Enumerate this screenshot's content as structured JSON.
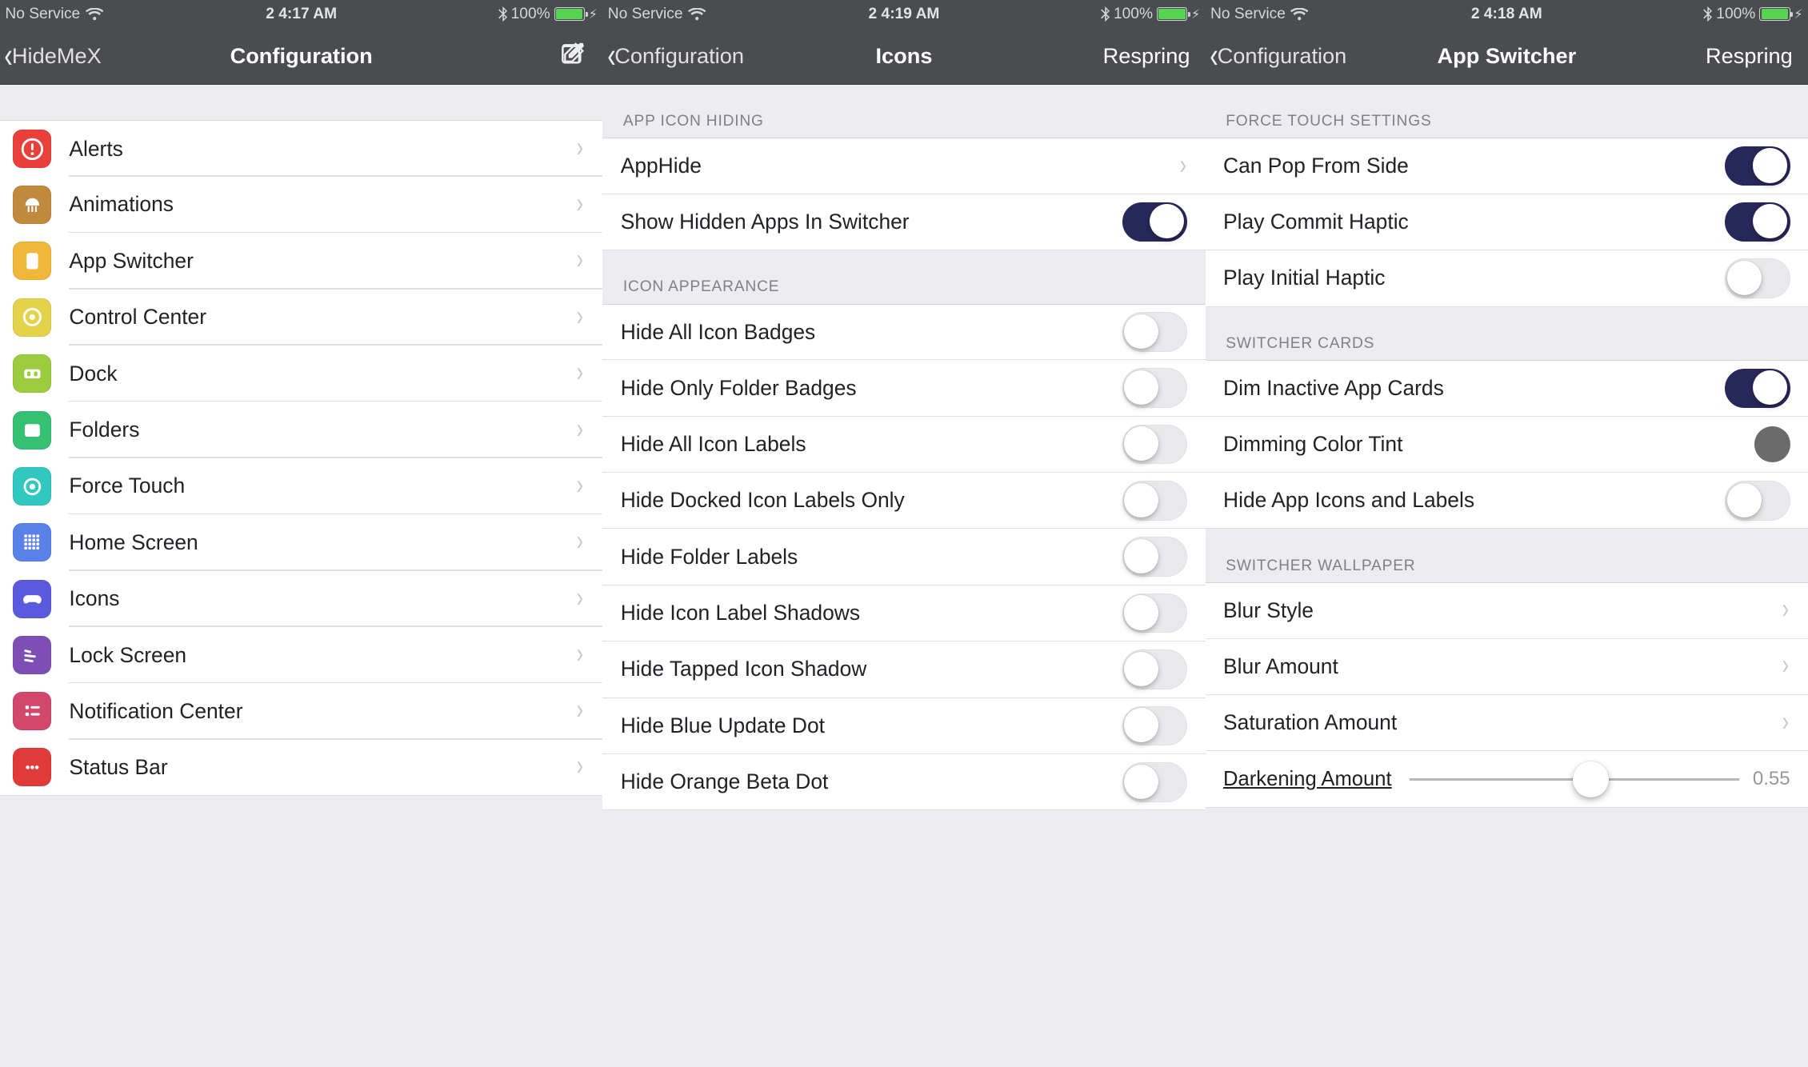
{
  "status": {
    "carrier": "No Service",
    "times": [
      "2 4:17 AM",
      "2 4:19 AM",
      "2 4:18 AM"
    ],
    "battery_pct": "100%"
  },
  "screen1": {
    "back_label": "HideMeX",
    "title": "Configuration",
    "rows": [
      {
        "label": "Alerts",
        "icon_bg": "#e9403a",
        "icon": "exclaim"
      },
      {
        "label": "Animations",
        "icon_bg": "#c08a3c",
        "icon": "jelly"
      },
      {
        "label": "App Switcher",
        "icon_bg": "#f0b83b",
        "icon": "card"
      },
      {
        "label": "Control Center",
        "icon_bg": "#e4d24b",
        "icon": "cc"
      },
      {
        "label": "Dock",
        "icon_bg": "#9bcd3e",
        "icon": "dock"
      },
      {
        "label": "Folders",
        "icon_bg": "#35c074",
        "icon": "folder"
      },
      {
        "label": "Force Touch",
        "icon_bg": "#30c8bf",
        "icon": "circle"
      },
      {
        "label": "Home Screen",
        "icon_bg": "#5a81e8",
        "icon": "grid"
      },
      {
        "label": "Icons",
        "icon_bg": "#5a5adf",
        "icon": "game"
      },
      {
        "label": "Lock Screen",
        "icon_bg": "#7d4fb5",
        "icon": "lines"
      },
      {
        "label": "Notification Center",
        "icon_bg": "#d2476c",
        "icon": "list"
      },
      {
        "label": "Status Bar",
        "icon_bg": "#e03a3a",
        "icon": "dots"
      }
    ]
  },
  "screen2": {
    "back_label": "Configuration",
    "title": "Icons",
    "right_label": "Respring",
    "groups": [
      {
        "header": "APP ICON HIDING",
        "rows": [
          {
            "label": "AppHide",
            "type": "chevron"
          },
          {
            "label": "Show Hidden Apps In Switcher",
            "type": "toggle",
            "on": true
          }
        ]
      },
      {
        "header": "ICON APPEARANCE",
        "rows": [
          {
            "label": "Hide All Icon Badges",
            "type": "toggle",
            "on": false
          },
          {
            "label": "Hide Only Folder Badges",
            "type": "toggle",
            "on": false
          },
          {
            "label": "Hide All Icon Labels",
            "type": "toggle",
            "on": false
          },
          {
            "label": "Hide Docked Icon Labels Only",
            "type": "toggle",
            "on": false
          },
          {
            "label": "Hide Folder Labels",
            "type": "toggle",
            "on": false
          },
          {
            "label": "Hide Icon Label Shadows",
            "type": "toggle",
            "on": false
          },
          {
            "label": "Hide Tapped Icon Shadow",
            "type": "toggle",
            "on": false
          },
          {
            "label": "Hide Blue Update Dot",
            "type": "toggle",
            "on": false
          },
          {
            "label": "Hide Orange Beta Dot",
            "type": "toggle",
            "on": false
          }
        ]
      }
    ]
  },
  "screen3": {
    "back_label": "Configuration",
    "title": "App Switcher",
    "right_label": "Respring",
    "groups": [
      {
        "header": "FORCE TOUCH SETTINGS",
        "rows": [
          {
            "label": "Can Pop From Side",
            "type": "toggle",
            "on": true
          },
          {
            "label": "Play Commit Haptic",
            "type": "toggle",
            "on": true
          },
          {
            "label": "Play Initial Haptic",
            "type": "toggle",
            "on": false
          }
        ]
      },
      {
        "header": "SWITCHER CARDS",
        "rows": [
          {
            "label": "Dim Inactive App Cards",
            "type": "toggle",
            "on": true
          },
          {
            "label": "Dimming Color Tint",
            "type": "color",
            "color": "#6b6b6b"
          },
          {
            "label": "Hide App Icons and Labels",
            "type": "toggle",
            "on": false
          }
        ]
      },
      {
        "header": "SWITCHER WALLPAPER",
        "rows": [
          {
            "label": "Blur Style",
            "type": "chevron"
          },
          {
            "label": "Blur Amount",
            "type": "chevron"
          },
          {
            "label": "Saturation Amount",
            "type": "chevron"
          },
          {
            "label": "Darkening Amount",
            "type": "slider",
            "value_text": "0.55",
            "value_frac": 0.55
          }
        ]
      }
    ]
  }
}
